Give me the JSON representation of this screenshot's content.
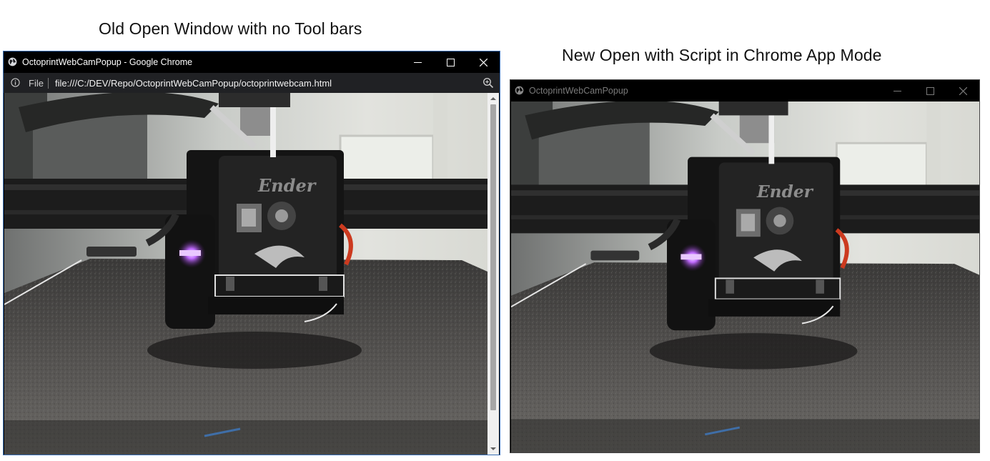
{
  "captions": {
    "old": "Old Open Window with no Tool bars",
    "new": "New Open with Script in Chrome App Mode"
  },
  "window_old": {
    "title": "OctoprintWebCamPopup - Google Chrome",
    "icon": "globe-icon",
    "controls": [
      "minimize-icon",
      "maximize-icon",
      "close-icon"
    ],
    "address": {
      "info_icon": "info-icon",
      "scheme_label": "File",
      "url": "file:///C:/DEV/Repo/OctoprintWebCamPopup/octoprintwebcam.html",
      "zoom_icon": "zoom-icon"
    },
    "scrollbar": {
      "arrows": [
        "scroll-up-arrow",
        "scroll-down-arrow"
      ]
    },
    "content": "webcam-image"
  },
  "window_new": {
    "title": "OctoprintWebCamPopup",
    "icon": "globe-icon",
    "controls": [
      "minimize-icon",
      "maximize-icon",
      "close-icon"
    ],
    "content": "webcam-image"
  },
  "webcam_logo_text": "Ender",
  "colors": {
    "titlebar_bg": "#000000",
    "addressbar_bg": "#202124",
    "window_border_active": "#3b6fb5",
    "scrollbar_track": "#f0f0f0",
    "scrollbar_thumb": "#a6a6a6"
  }
}
